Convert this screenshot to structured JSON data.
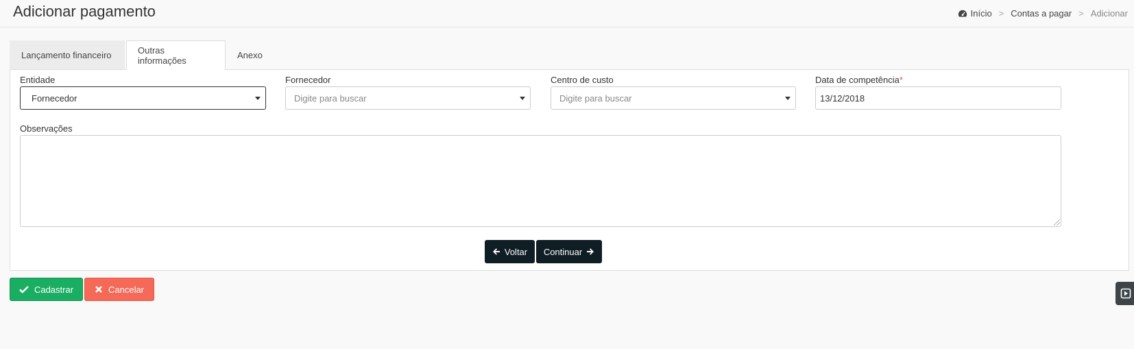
{
  "header": {
    "title": "Adicionar pagamento",
    "breadcrumb": {
      "home": "Início",
      "section": "Contas a pagar",
      "current": "Adicionar",
      "separator": ">"
    }
  },
  "tabs": [
    {
      "label": "Lançamento financeiro"
    },
    {
      "label": "Outras informações"
    },
    {
      "label": "Anexo"
    }
  ],
  "form": {
    "entidade": {
      "label": "Entidade",
      "value": "Fornecedor"
    },
    "fornecedor": {
      "label": "Fornecedor",
      "placeholder": "Digite para buscar"
    },
    "centro_custo": {
      "label": "Centro de custo",
      "placeholder": "Digite para buscar"
    },
    "data_competencia": {
      "label": "Data de competência",
      "required_mark": "*",
      "value": "13/12/2018"
    },
    "observacoes": {
      "label": "Observações",
      "value": ""
    }
  },
  "nav_buttons": {
    "back_label": "Voltar",
    "continue_label": "Continuar"
  },
  "actions": {
    "save_label": "Cadastrar",
    "cancel_label": "Cancelar"
  },
  "colors": {
    "success": "#1aae63",
    "danger": "#f46957",
    "dark_button": "#0f1d24"
  },
  "icons": {
    "home": "dashboard-icon",
    "back": "arrow-left-icon",
    "continue": "arrow-right-icon",
    "save": "check-icon",
    "cancel": "close-icon",
    "side": "play-square-icon"
  }
}
